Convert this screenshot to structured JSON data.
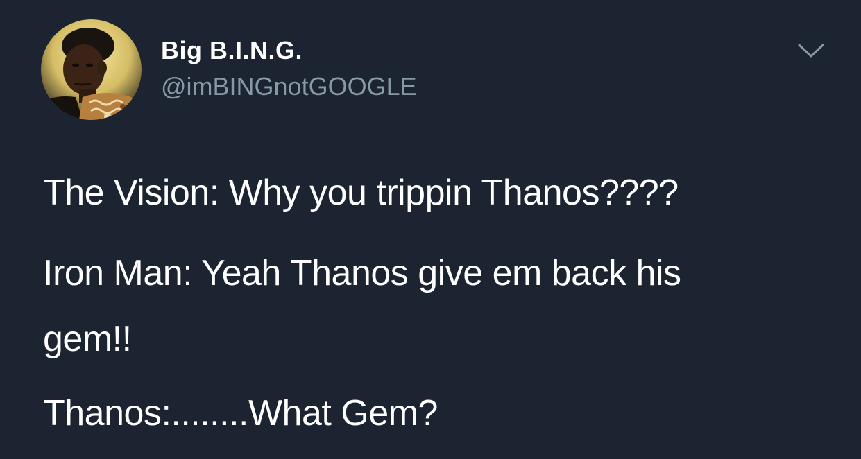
{
  "author": {
    "display_name": "Big B.I.N.G.",
    "handle": "@imBINGnotGOOGLE",
    "avatar_icon": "profile-avatar"
  },
  "menu": {
    "icon": "chevron-down-icon"
  },
  "tweet": {
    "lines": [
      "The Vision: Why you trippin Thanos????",
      "Iron Man: Yeah Thanos give em back his",
      "gem!!",
      "Thanos:........What Gem?"
    ]
  },
  "colors": {
    "background": "#1c2432",
    "text": "#ffffff",
    "secondary_text": "#8899a6",
    "caret": "#8899a6"
  }
}
